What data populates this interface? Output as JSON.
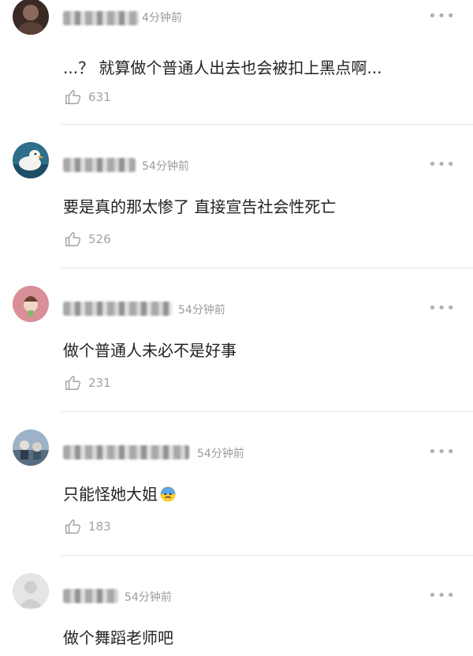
{
  "comments": [
    {
      "time": "4分钟前",
      "text": "...？ 就算做个普通人出去也会被扣上黑点啊...",
      "likes": "631",
      "avatar": "dark-portrait"
    },
    {
      "time": "54分钟前",
      "text": "要是真的那太惨了 直接宣告社会性死亡",
      "likes": "526",
      "avatar": "duck"
    },
    {
      "time": "54分钟前",
      "text": "做个普通人未必不是好事",
      "likes": "231",
      "avatar": "pink-cartoon"
    },
    {
      "time": "54分钟前",
      "text": "只能怪她大姐",
      "likes": "183",
      "avatar": "anime-scene",
      "emoji": "anxious-sweat-emoji"
    },
    {
      "time": "54分钟前",
      "text": "做个舞蹈老师吧",
      "likes": "",
      "avatar": "default-user"
    }
  ],
  "icons": {
    "more": "more-dots-icon",
    "like": "thumb-up-icon"
  },
  "colors": {
    "text": "#222222",
    "muted": "#9b9b9b",
    "divider": "#e6e6e6"
  }
}
